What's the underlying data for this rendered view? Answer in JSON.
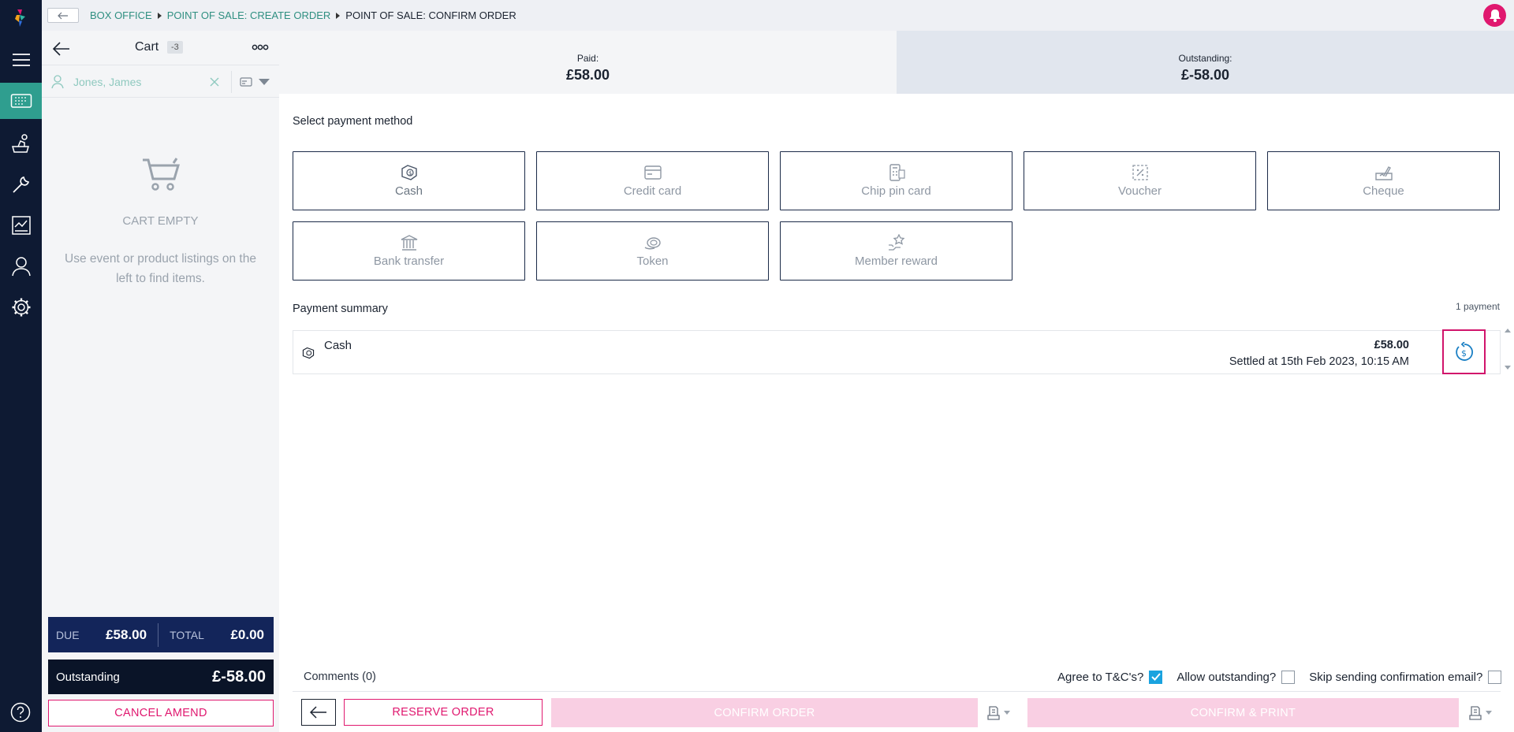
{
  "breadcrumb": {
    "items": [
      "BOX OFFICE",
      "POINT OF SALE: CREATE ORDER"
    ],
    "current": "POINT OF SALE: CONFIRM ORDER"
  },
  "nav": {
    "items": [
      "hamburger-menu",
      "tickets",
      "shopping",
      "tools",
      "reports",
      "customers",
      "settings"
    ],
    "active": "tickets"
  },
  "cart": {
    "title": "Cart",
    "count": "-3",
    "customer_name": "Jones, James",
    "empty_title": "CART EMPTY",
    "empty_text": "Use event or product listings on the left to find items.",
    "due_label": "DUE",
    "due_value": "£58.00",
    "total_label": "TOTAL",
    "total_value": "£0.00",
    "outstanding_label": "Outstanding",
    "outstanding_value": "£-58.00",
    "cancel_label": "CANCEL AMEND"
  },
  "payment": {
    "paid_label": "Paid:",
    "paid_value": "£58.00",
    "outstanding_label": "Outstanding:",
    "outstanding_value": "£-58.00",
    "select_heading": "Select payment method",
    "methods": [
      "Cash",
      "Credit card",
      "Chip pin card",
      "Voucher",
      "Cheque",
      "Bank transfer",
      "Token",
      "Member reward"
    ],
    "summary_heading": "Payment summary",
    "payment_count": "1 payment",
    "summary": {
      "method": "Cash",
      "amount": "£58.00",
      "settled": "Settled at 15th Feb 2023, 10:15 AM"
    }
  },
  "footer": {
    "comments": "Comments (0)",
    "agree_label": "Agree to T&C's?",
    "agree_checked": true,
    "allow_outstanding_label": "Allow outstanding?",
    "allow_outstanding_checked": false,
    "skip_email_label": "Skip sending confirmation email?",
    "skip_email_checked": false,
    "reserve_label": "RESERVE ORDER",
    "confirm_label": "CONFIRM ORDER",
    "confirm_print_label": "CONFIRM & PRINT"
  },
  "colors": {
    "nav_bg": "#0e1a33",
    "accent_teal": "#2f9e8f",
    "accent_pink": "#e0186f",
    "totals_bg": "#13255a",
    "outstanding_bg": "#0a1428",
    "checkbox_blue": "#1aa3df"
  }
}
